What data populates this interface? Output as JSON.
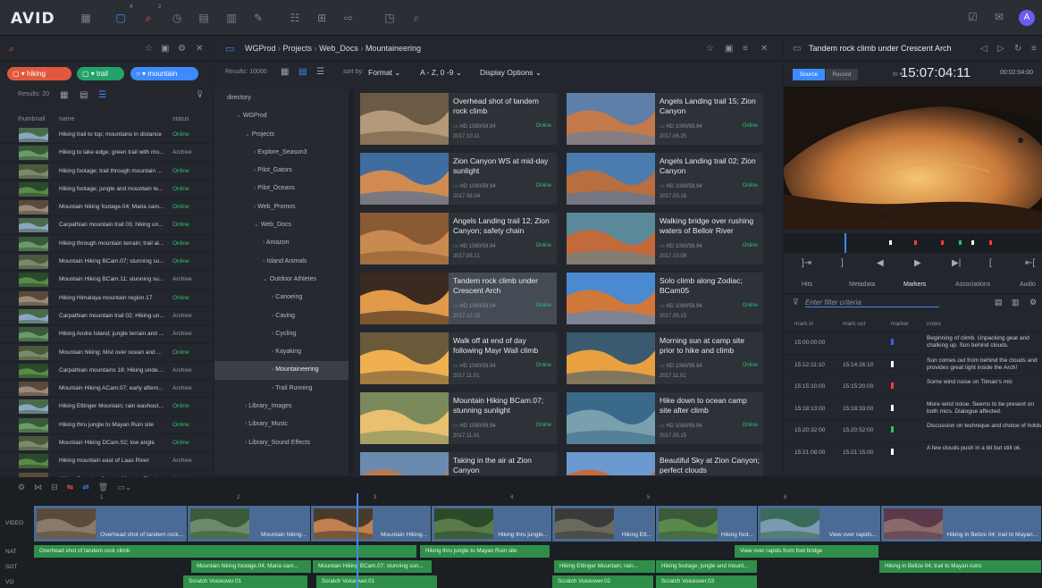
{
  "app": {
    "logo": "AVID"
  },
  "topbar": {
    "badge_a": "4",
    "badge_b": "2"
  },
  "browser": {
    "chips": [
      "▢ ▾ hiking",
      "▢ ▾ trail",
      "○ ▾ mountain"
    ],
    "results": "Results: 20",
    "col_thumbnail": "thumbnail",
    "col_name": "name",
    "col_status": "status",
    "items": [
      {
        "name": "Hiking trail to top; mountains in distance",
        "status": "Online"
      },
      {
        "name": "Hiking to lake edge; green trail with mo...",
        "status": "Archive"
      },
      {
        "name": "Hiking footage; trail through mountain ...",
        "status": "Online"
      },
      {
        "name": "Hiking footage; jungle and mountain te...",
        "status": "Online"
      },
      {
        "name": "Mountain hiking footage.04; Maria cam...",
        "status": "Online"
      },
      {
        "name": "Carpathian mountain trail 03; hiking un...",
        "status": "Online"
      },
      {
        "name": "Hiking through mountain terrain; trail al...",
        "status": "Online"
      },
      {
        "name": "Mountain Hiking BCam.07; stunning su...",
        "status": "Online"
      },
      {
        "name": "Mountain Hiking BCam.11; stunning su...",
        "status": "Archive"
      },
      {
        "name": "Hiking Himalaya mountain region.17",
        "status": "Online"
      },
      {
        "name": "Carpathian mountain trail 02; Hiking un...",
        "status": "Archive"
      },
      {
        "name": "Hiking Andre Island; jungle terrain and ...",
        "status": "Archive"
      },
      {
        "name": "Mountain hiking; Mist over ocean and w...",
        "status": "Online"
      },
      {
        "name": "Carpathian mountains 18; Hiking under ...",
        "status": "Archive"
      },
      {
        "name": "Mountain Hiking ACam.07; early aftern...",
        "status": "Archive"
      },
      {
        "name": "Hiking Ettinger Mountain; rain washout ...",
        "status": "Online"
      },
      {
        "name": "Hiking thru jungle to Mayan Ruin site",
        "status": "Online"
      },
      {
        "name": "Mountain Hiking DCam.02; low angle",
        "status": "Online"
      },
      {
        "name": "Hiking mountain east of Laas River",
        "status": "Archive"
      },
      {
        "name": "Hiking Peruvian Jungle; Macchu Picchu",
        "status": "Archive"
      }
    ]
  },
  "project": {
    "crumbs": [
      "WGProd",
      "Projects",
      "Web_Docs",
      "Mountaineering"
    ],
    "results": "Results: 10000",
    "sort_by": "sort by:",
    "sort_format": "Format",
    "sort_order": "A - Z, 0 -9",
    "display_options": "Display Options",
    "tree": [
      {
        "label": "directory",
        "indent": 0,
        "sel": false
      },
      {
        "label": "WGProd",
        "indent": 1,
        "sel": false,
        "open": true
      },
      {
        "label": "Projects",
        "indent": 2,
        "sel": false,
        "open": true
      },
      {
        "label": "Explore_Season3",
        "indent": 3,
        "sel": false
      },
      {
        "label": "Pilot_Gators",
        "indent": 3,
        "sel": false
      },
      {
        "label": "Pilot_Oceans",
        "indent": 3,
        "sel": false
      },
      {
        "label": "Web_Promos",
        "indent": 3,
        "sel": false
      },
      {
        "label": "Web_Docs",
        "indent": 3,
        "sel": false,
        "open": true
      },
      {
        "label": "Amazon",
        "indent": 4,
        "sel": false
      },
      {
        "label": "Island Animals",
        "indent": 4,
        "sel": false
      },
      {
        "label": "Outdoor Athletes",
        "indent": 4,
        "sel": false,
        "open": true
      },
      {
        "label": "Canoeing",
        "indent": 5,
        "sel": false
      },
      {
        "label": "Caving",
        "indent": 5,
        "sel": false
      },
      {
        "label": "Cycling",
        "indent": 5,
        "sel": false
      },
      {
        "label": "Kayaking",
        "indent": 5,
        "sel": false
      },
      {
        "label": "Mountaineering",
        "indent": 5,
        "sel": true
      },
      {
        "label": "Trail Running",
        "indent": 5,
        "sel": false
      },
      {
        "label": "Library_Images",
        "indent": 2,
        "sel": false
      },
      {
        "label": "Library_Music",
        "indent": 2,
        "sel": false
      },
      {
        "label": "Library_Sound Effects",
        "indent": 2,
        "sel": false
      }
    ],
    "cards": [
      {
        "title": "Overhead shot of tandem rock climb",
        "format": "HD 1080/59.94",
        "status": "Online",
        "date": "2017.10.11",
        "sel": false,
        "c1": "#b49a7a",
        "c2": "#6d5a44"
      },
      {
        "title": "Angels Landing trail 15; Zion Canyon",
        "format": "HD 1080/59.94",
        "status": "Online",
        "date": "2017.06.25",
        "sel": false,
        "c1": "#c27a4a",
        "c2": "#5d7fa8"
      },
      {
        "title": "Zion Canyon WS at mid-day sunlight",
        "format": "HD 1080/59.94",
        "status": "Online",
        "date": "2017.08.04",
        "sel": false,
        "c1": "#d08a52",
        "c2": "#3f6da0"
      },
      {
        "title": "Angels Landing trail 02; Zion Canyon",
        "format": "HD 1080/59.94",
        "status": "Online",
        "date": "2017.03.16",
        "sel": false,
        "c1": "#b86e3f",
        "c2": "#4a7cb0"
      },
      {
        "title": "Angels Landing trail 12; Zion Canyon; safety chain",
        "format": "HD 1080/59.94",
        "status": "Online",
        "date": "2017.05.21",
        "sel": false,
        "c1": "#c98a50",
        "c2": "#8a5a34"
      },
      {
        "title": "Walking bridge over rushing waters of Belloir River",
        "format": "HD 1080/59.94",
        "status": "Online",
        "date": "2017.10.06",
        "sel": false,
        "c1": "#c26a3c",
        "c2": "#5a8a9a"
      },
      {
        "title": "Tandem rock climb under Crescent Arch",
        "format": "HD 1080/59.94",
        "status": "Online",
        "date": "2017.12.15",
        "sel": true,
        "c1": "#e09a4a",
        "c2": "#3a2a20"
      },
      {
        "title": "Solo climb along Zodiac; BCam05",
        "format": "HD 1080/59.94",
        "status": "Online",
        "date": "2017.05.15",
        "sel": false,
        "c1": "#d0783a",
        "c2": "#4a8ad0"
      },
      {
        "title": "Walk off at end of day following Mayr Wall climb",
        "format": "HD 1080/59.94",
        "status": "Online",
        "date": "2017.11.01",
        "sel": false,
        "c1": "#f0b050",
        "c2": "#6a5a3a"
      },
      {
        "title": "Morning sun at camp site prior to hike and climb",
        "format": "HD 1080/59.94",
        "status": "Online",
        "date": "2017.11.01",
        "sel": false,
        "c1": "#e8a040",
        "c2": "#3a5a70"
      },
      {
        "title": "Mountain Hiking BCam.07; stunning sunlight",
        "format": "HD 1080/59.94",
        "status": "Online",
        "date": "2017.11.01",
        "sel": false,
        "c1": "#e8c070",
        "c2": "#7a8a5a"
      },
      {
        "title": "Hike down to ocean camp site after climb",
        "format": "HD 1080/59.94",
        "status": "Online",
        "date": "2017.05.15",
        "sel": false,
        "c1": "#7aa0b0",
        "c2": "#3a6a8a"
      },
      {
        "title": "Taking in the air at Zion Canyon",
        "format": "",
        "status": "",
        "date": "",
        "sel": false,
        "c1": "#c07a4a",
        "c2": "#6a8ab0"
      },
      {
        "title": "Beautiful Sky at Zion Canyon; perfect clouds",
        "format": "",
        "status": "",
        "date": "",
        "sel": false,
        "c1": "#c86a3a",
        "c2": "#6a9ad0"
      }
    ]
  },
  "viewer": {
    "title": "Tandem rock climb under Crescent Arch",
    "tab_source": "Source",
    "tab_record": "Record",
    "timecode_prefix": "m ▾",
    "timecode": "15:07:04:11",
    "duration": "00:02:04:00",
    "tabs": [
      "Hits",
      "Metadata",
      "Markers",
      "Associations",
      "Audio"
    ],
    "filter_placeholder": "Enter filter criteria",
    "cols": [
      "mark in",
      "mark out",
      "marker",
      "notes"
    ],
    "markers": [
      {
        "in": "15:00:00:00",
        "out": "",
        "color": "#3d5aff",
        "note": "Beginning of climb. Unpacking gear and chalking up. Sun behind clouds."
      },
      {
        "in": "15:12:11:10",
        "out": "15:14:26:10",
        "color": "#ffffff",
        "note": "Sun comes out from behind the clouds and provides great light inside the Arch!"
      },
      {
        "in": "15:15:10:00",
        "out": "15:15:20:00",
        "color": "#ff3a3a",
        "note": "Some wind noise on Tilman's mic"
      },
      {
        "in": "15:18:13:00",
        "out": "15:18:33:00",
        "color": "#ffffff",
        "note": "More wind noise. Seems to be present on both mics. Dialogue affected."
      },
      {
        "in": "15:20:32:00",
        "out": "15:20:52:00",
        "color": "#2fc36a",
        "note": "Discussion on technique and choice of holds"
      },
      {
        "in": "15:21:08:00",
        "out": "15:21:15:00",
        "color": "#ffffff",
        "note": "A few clouds push in a bit but still ok."
      }
    ]
  },
  "timeline": {
    "ruler": [
      "1",
      "2",
      "3",
      "4",
      "5",
      "6"
    ],
    "tracks": [
      "VIDEO",
      "NAT",
      "SOT",
      "VO"
    ],
    "video_clips": [
      {
        "label": "Overhead shot of tandem rock...",
        "c1": "#8a7a6a",
        "c2": "#5a4a3a"
      },
      {
        "label": "Mountain hiking...",
        "c1": "#6a8a6a",
        "c2": "#3a5a3a"
      },
      {
        "label": "Mountain Hiking...",
        "c1": "#c08050",
        "c2": "#4a3a2a"
      },
      {
        "label": "Hiking thru jungle...",
        "c1": "#5a7a4a",
        "c2": "#2a4a2a"
      },
      {
        "label": "Hiking Ett...",
        "c1": "#6a6a5a",
        "c2": "#3a3a3a"
      },
      {
        "label": "Hiking foot...",
        "c1": "#5a8a4a",
        "c2": "#3a5a3a"
      },
      {
        "label": "View over rapids...",
        "c1": "#7a9ab0",
        "c2": "#3a6a5a"
      },
      {
        "label": "Hiking in Belize 04; trail to Mayan...",
        "c1": "#8a6a6a",
        "c2": "#5a3a4a"
      }
    ],
    "nat_clips": [
      "Overhead shot of tandem rock climb",
      "Hiking thru jungle to Mayan Ruin site",
      "View over rapids from foot bridge"
    ],
    "sot_clips": [
      "Mountain hiking footage.04; Maria cam...",
      "Mountain Hiking BCam.07; stunning sun...",
      "Hiking Ettinger Mountain; rain...",
      "Hiking footage; jungle and mount...",
      "Hiking in Belize 04; trail to Mayan ruins"
    ],
    "vo_clips": [
      "Scratch Voiceover.01",
      "Scratch Voiceover.01",
      "Scratch Voiceover.02",
      "Scratch Voiceover.03"
    ]
  }
}
